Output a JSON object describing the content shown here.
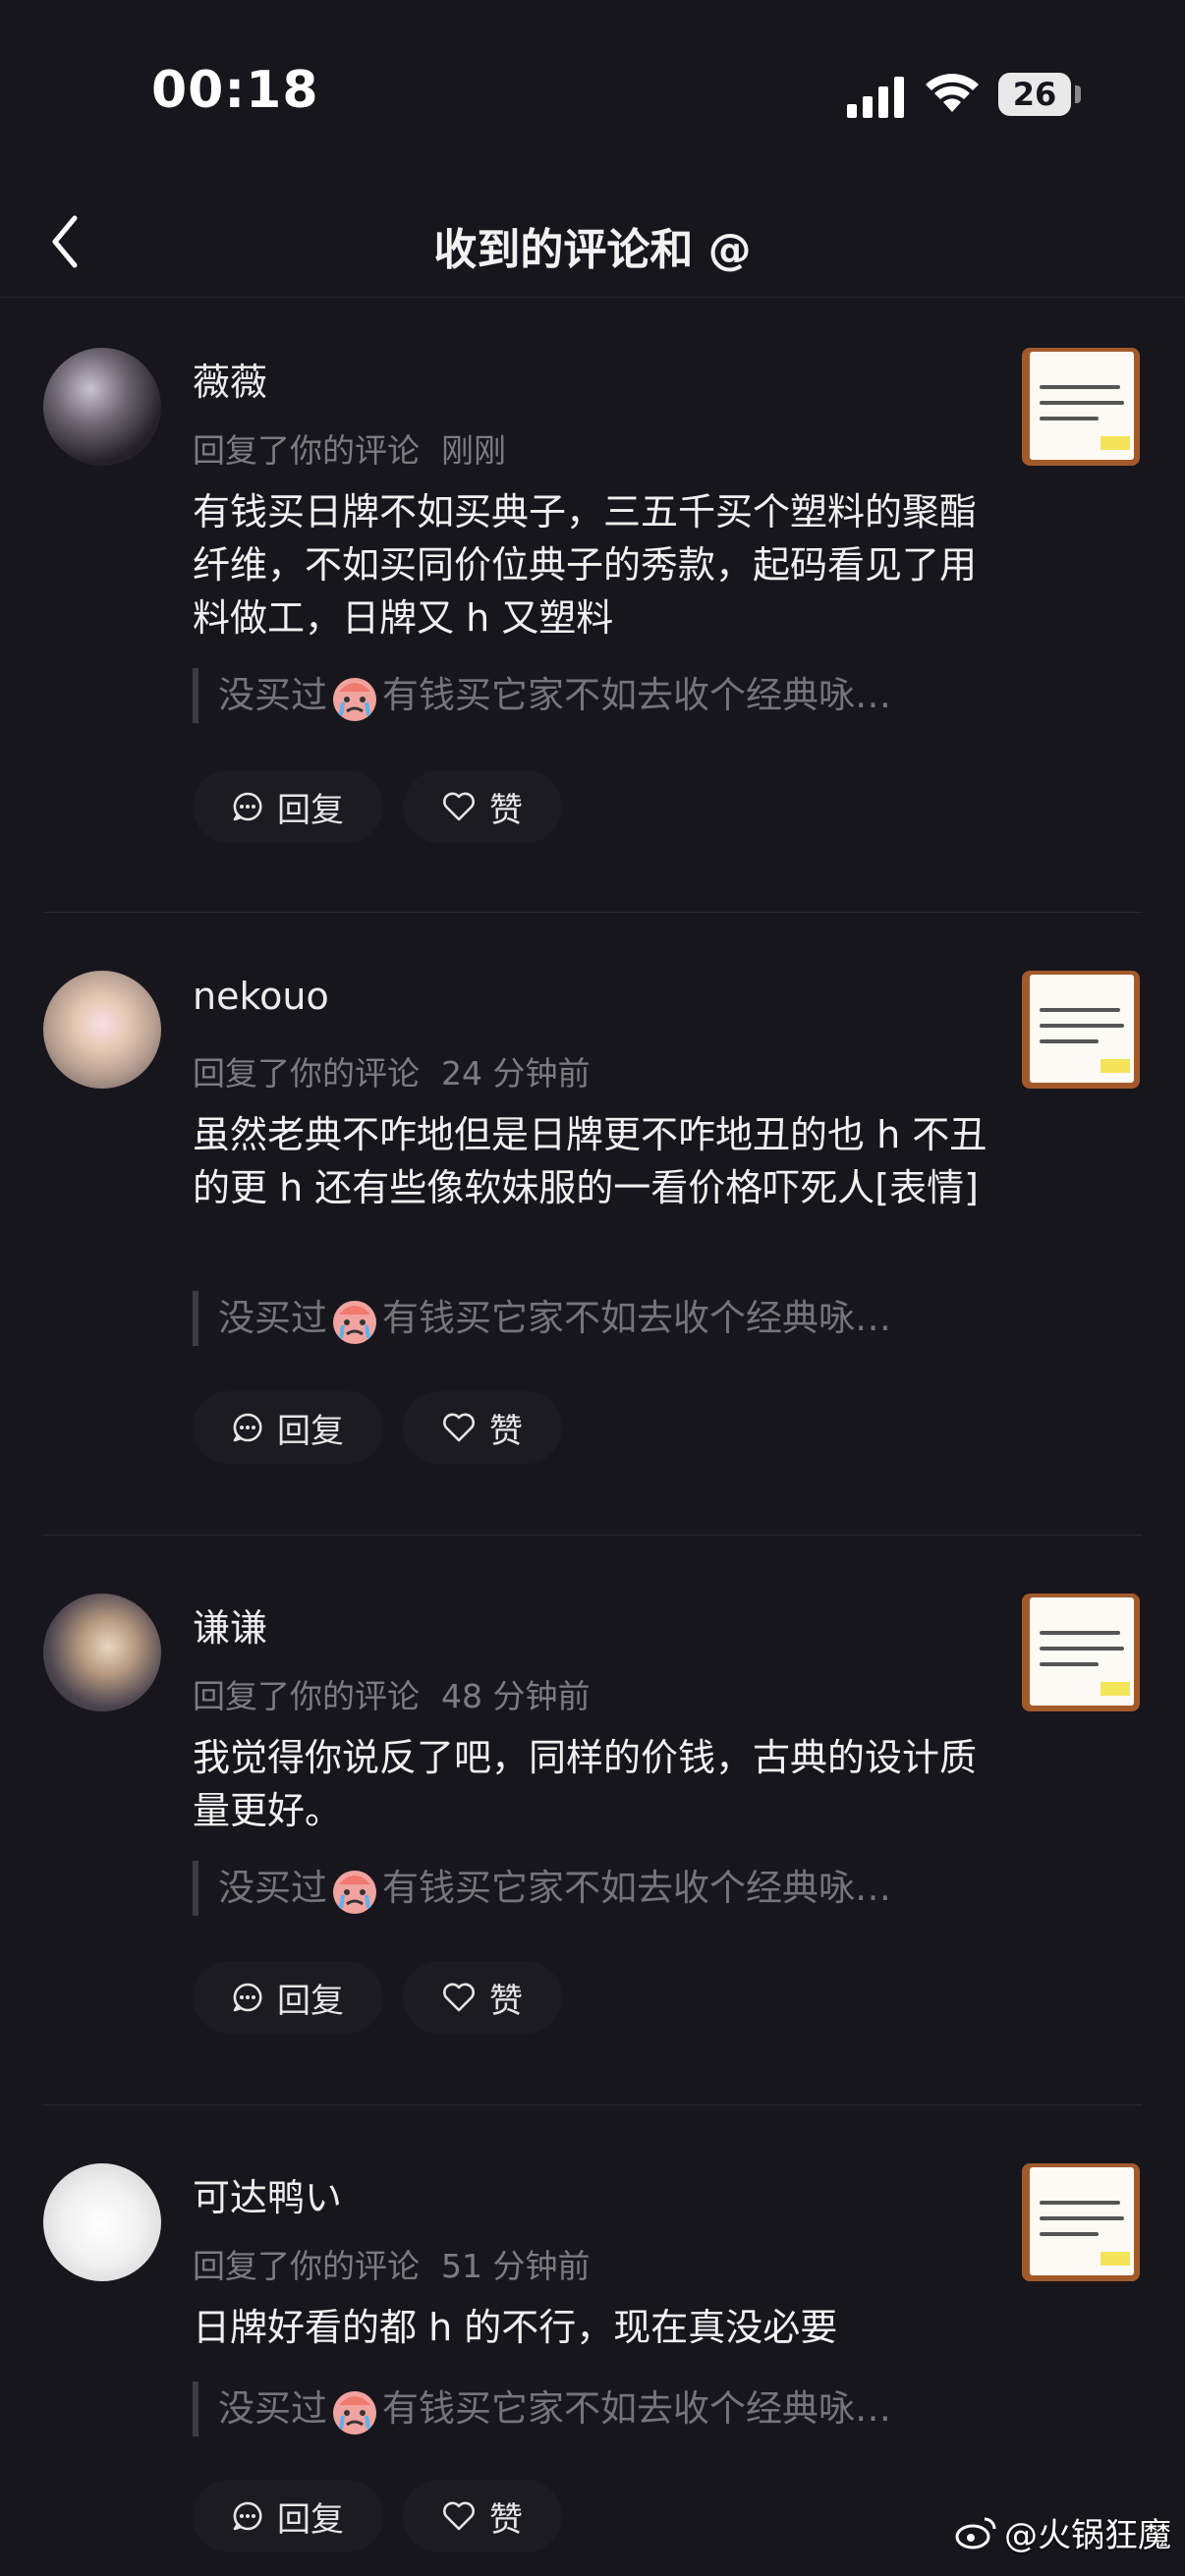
{
  "status_bar": {
    "time": "00:18",
    "battery": "26"
  },
  "nav": {
    "title": "收到的评论和 @"
  },
  "comments": [
    {
      "username": "薇薇",
      "action": "回复了你的评论",
      "time": "刚刚",
      "content": "有钱买日牌不如买典子，三五千买个塑料的聚酯纤维，不如买同价位典子的秀款，起码看见了用料做工，日牌又 h 又塑料",
      "quote_before": "没买过",
      "quote_after": "有钱买它家不如去收个经典咏…",
      "reply_label": "回复",
      "like_label": "赞"
    },
    {
      "username": "nekouo",
      "action": "回复了你的评论",
      "time": "24 分钟前",
      "content": "虽然老典不咋地但是日牌更不咋地丑的也 h 不丑的更 h 还有些像软妹服的一看价格吓死人[表情]",
      "quote_before": "没买过",
      "quote_after": "有钱买它家不如去收个经典咏…",
      "reply_label": "回复",
      "like_label": "赞"
    },
    {
      "username": "谦谦",
      "action": "回复了你的评论",
      "time": "48 分钟前",
      "content": "我觉得你说反了吧，同样的价钱，古典的设计质量更好。",
      "quote_before": "没买过",
      "quote_after": "有钱买它家不如去收个经典咏…",
      "reply_label": "回复",
      "like_label": "赞"
    },
    {
      "username": "可达鸭い",
      "action": "回复了你的评论",
      "time": "51 分钟前",
      "content": "日牌好看的都 h 的不行，现在真没必要",
      "quote_before": "没买过",
      "quote_after": "有钱买它家不如去收个经典咏…",
      "reply_label": "回复",
      "like_label": "赞"
    }
  ],
  "watermark": "@火锅狂魔",
  "colors": {
    "background": "#17161c",
    "text_primary": "#f1f1f1",
    "text_secondary": "#7c7b82",
    "button_bg": "#1c1b21"
  },
  "icons": [
    "back-arrow-icon",
    "signal-icon",
    "wifi-icon",
    "comment-bubble-icon",
    "heart-icon",
    "crying-emoji-icon",
    "weibo-logo-icon"
  ]
}
